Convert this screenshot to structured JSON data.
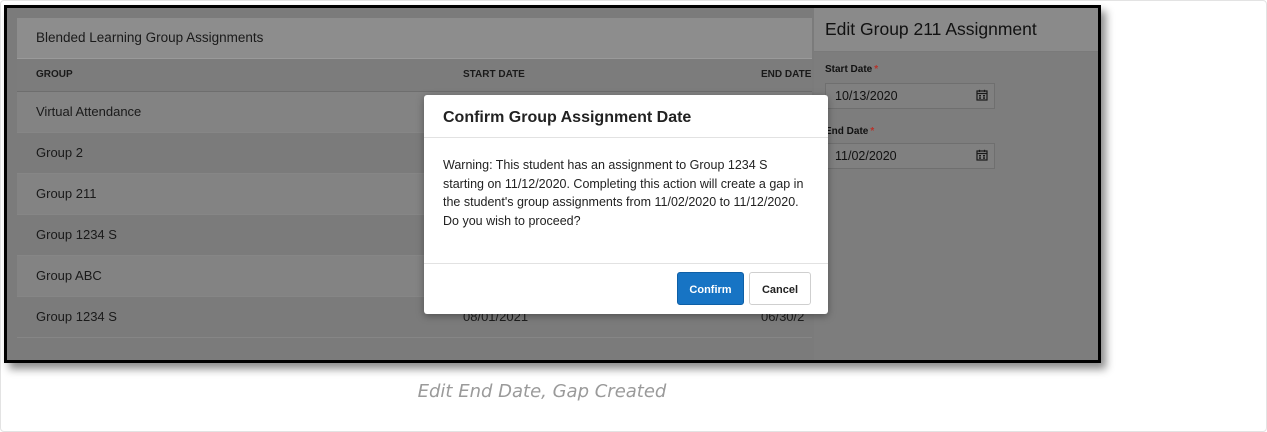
{
  "panel": {
    "title": "Blended Learning Group Assignments",
    "columns": [
      "GROUP",
      "START DATE",
      "END DATE"
    ],
    "rows": [
      {
        "group": "Virtual Attendance"
      },
      {
        "group": "Group 2"
      },
      {
        "group": "Group 211"
      },
      {
        "group": "Group 1234 S"
      },
      {
        "group": "Group ABC"
      },
      {
        "group": "Group 1234 S",
        "start": "08/01/2021",
        "end": "06/30/2"
      }
    ]
  },
  "side_panel": {
    "title": "Edit Group 211 Assignment",
    "start_label": "Start Date",
    "start_value": "10/13/2020",
    "end_label": "End Date",
    "end_value": "11/02/2020",
    "required_mark": "*"
  },
  "modal": {
    "title": "Confirm Group Assignment Date",
    "body": "Warning: This student has an assignment to Group 1234 S starting on 11/12/2020. Completing this action will create a gap in the student's group assignments from 11/02/2020 to 11/12/2020. Do you wish to proceed?",
    "confirm_label": "Confirm",
    "cancel_label": "Cancel"
  },
  "caption": "Edit End Date, Gap Created",
  "colors": {
    "confirm_button": "#1774c4",
    "required_asterisk": "#b8322a",
    "overlay": "#7b7b7b"
  },
  "icons": [
    "calendar-icon"
  ]
}
